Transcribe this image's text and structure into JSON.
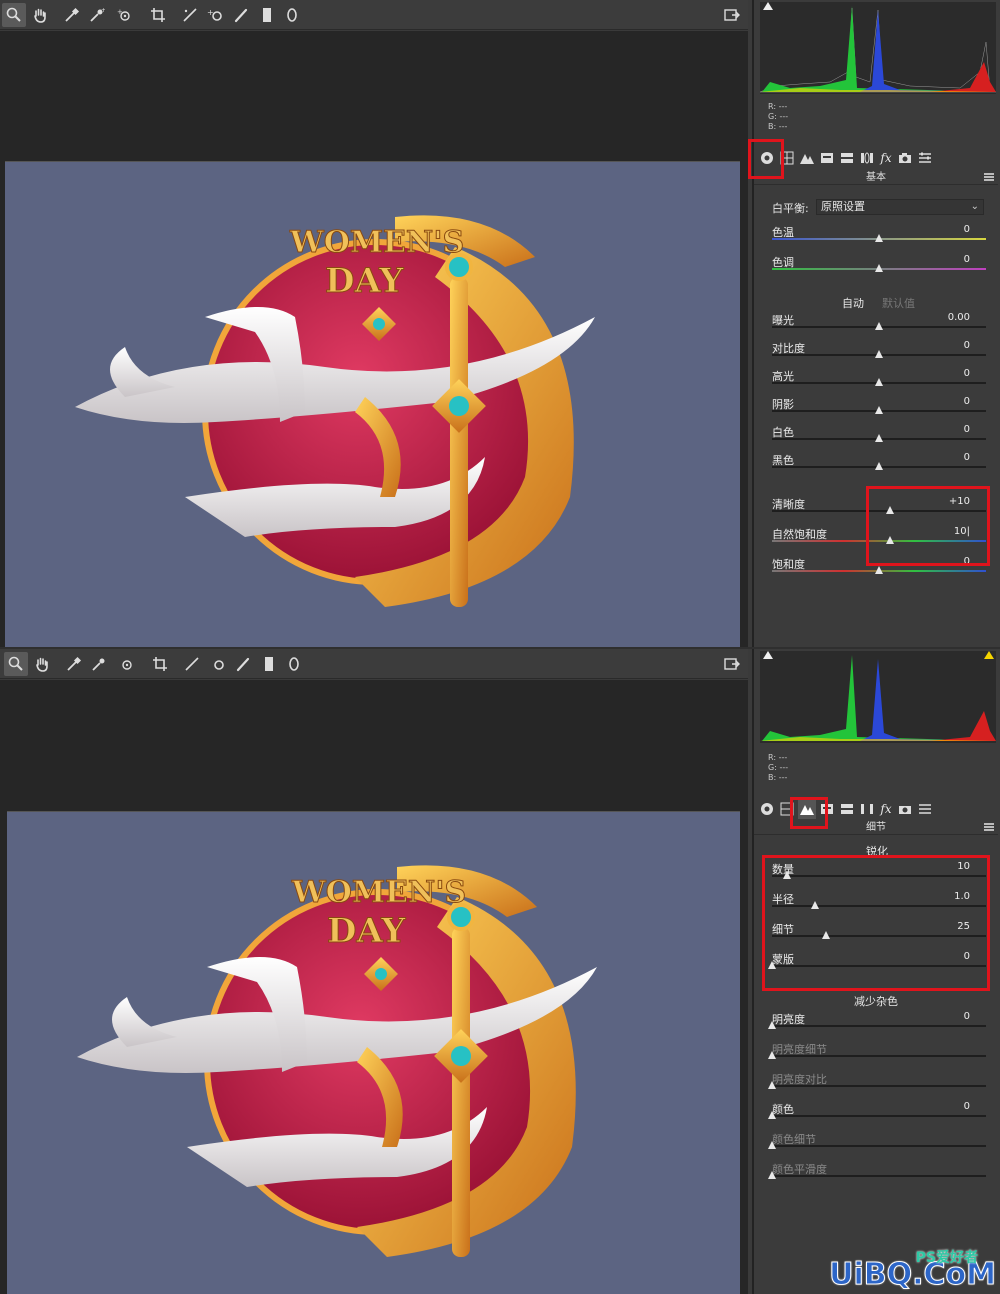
{
  "screen1": {
    "toolbar": {
      "tools": [
        "zoom-icon",
        "hand-icon",
        "white-balance-icon",
        "color-sampler-icon",
        "targeted-adjustment-icon",
        "crop-icon",
        "straighten-icon",
        "spot-removal-icon",
        "adjustment-brush-icon",
        "graduated-filter-icon",
        "radial-filter-icon"
      ],
      "right_icon": "open-image-icon"
    },
    "rgb": {
      "r": "R:",
      "g": "G:",
      "b": "B:",
      "r_val": "---",
      "g_val": "---",
      "b_val": "---"
    },
    "panel_title": "基本",
    "white_balance": {
      "label": "白平衡:",
      "value": "原照设置"
    },
    "wb_sliders": [
      {
        "label": "色温",
        "value": "0",
        "pos": 0.5,
        "track": "temp"
      },
      {
        "label": "色调",
        "value": "0",
        "pos": 0.5,
        "track": "tint"
      }
    ],
    "auto_label": "自动",
    "default_label": "默认值",
    "tone_sliders": [
      {
        "label": "曝光",
        "value": "0.00",
        "pos": 0.5
      },
      {
        "label": "对比度",
        "value": "0",
        "pos": 0.5
      },
      {
        "label": "高光",
        "value": "0",
        "pos": 0.5
      },
      {
        "label": "阴影",
        "value": "0",
        "pos": 0.5
      },
      {
        "label": "白色",
        "value": "0",
        "pos": 0.5
      },
      {
        "label": "黑色",
        "value": "0",
        "pos": 0.5
      }
    ],
    "presence_sliders": [
      {
        "label": "清晰度",
        "value": "+10",
        "pos": 0.55
      },
      {
        "label": "自然饱和度",
        "value": "10|",
        "pos": 0.55,
        "track": "sat"
      },
      {
        "label": "饱和度",
        "value": "0",
        "pos": 0.5,
        "track": "sat"
      }
    ],
    "emblem_text": {
      "line1": "WOMEN'S",
      "line2": "DAY"
    }
  },
  "screen2": {
    "panel_title": "细节",
    "sharpen_header": "锐化",
    "sharpen_sliders": [
      {
        "label": "数量",
        "value": "10",
        "pos": 0.07
      },
      {
        "label": "半径",
        "value": "1.0",
        "pos": 0.2
      },
      {
        "label": "细节",
        "value": "25",
        "pos": 0.25
      },
      {
        "label": "蒙版",
        "value": "0",
        "pos": 0.0
      }
    ],
    "noise_header": "减少杂色",
    "noise_sliders": [
      {
        "label": "明亮度",
        "value": "0",
        "pos": 0.0,
        "dim": false
      },
      {
        "label": "明亮度细节",
        "value": "",
        "pos": 0.0,
        "dim": true
      },
      {
        "label": "明亮度对比",
        "value": "",
        "pos": 0.0,
        "dim": true
      },
      {
        "label": "颜色",
        "value": "0",
        "pos": 0.0,
        "dim": false
      },
      {
        "label": "颜色细节",
        "value": "",
        "pos": 0.0,
        "dim": true
      },
      {
        "label": "颜色平滑度",
        "value": "",
        "pos": 0.0,
        "dim": true
      }
    ],
    "emblem_text": {
      "line1": "WOMEN'S",
      "line2": "DAY"
    }
  },
  "watermark": {
    "main": "UiBQ.CoM",
    "sub": "PS爱好者"
  },
  "colors": {
    "highlight": "#e0141c",
    "image_bg": "#5c6482",
    "panel": "#3b3b3b"
  }
}
